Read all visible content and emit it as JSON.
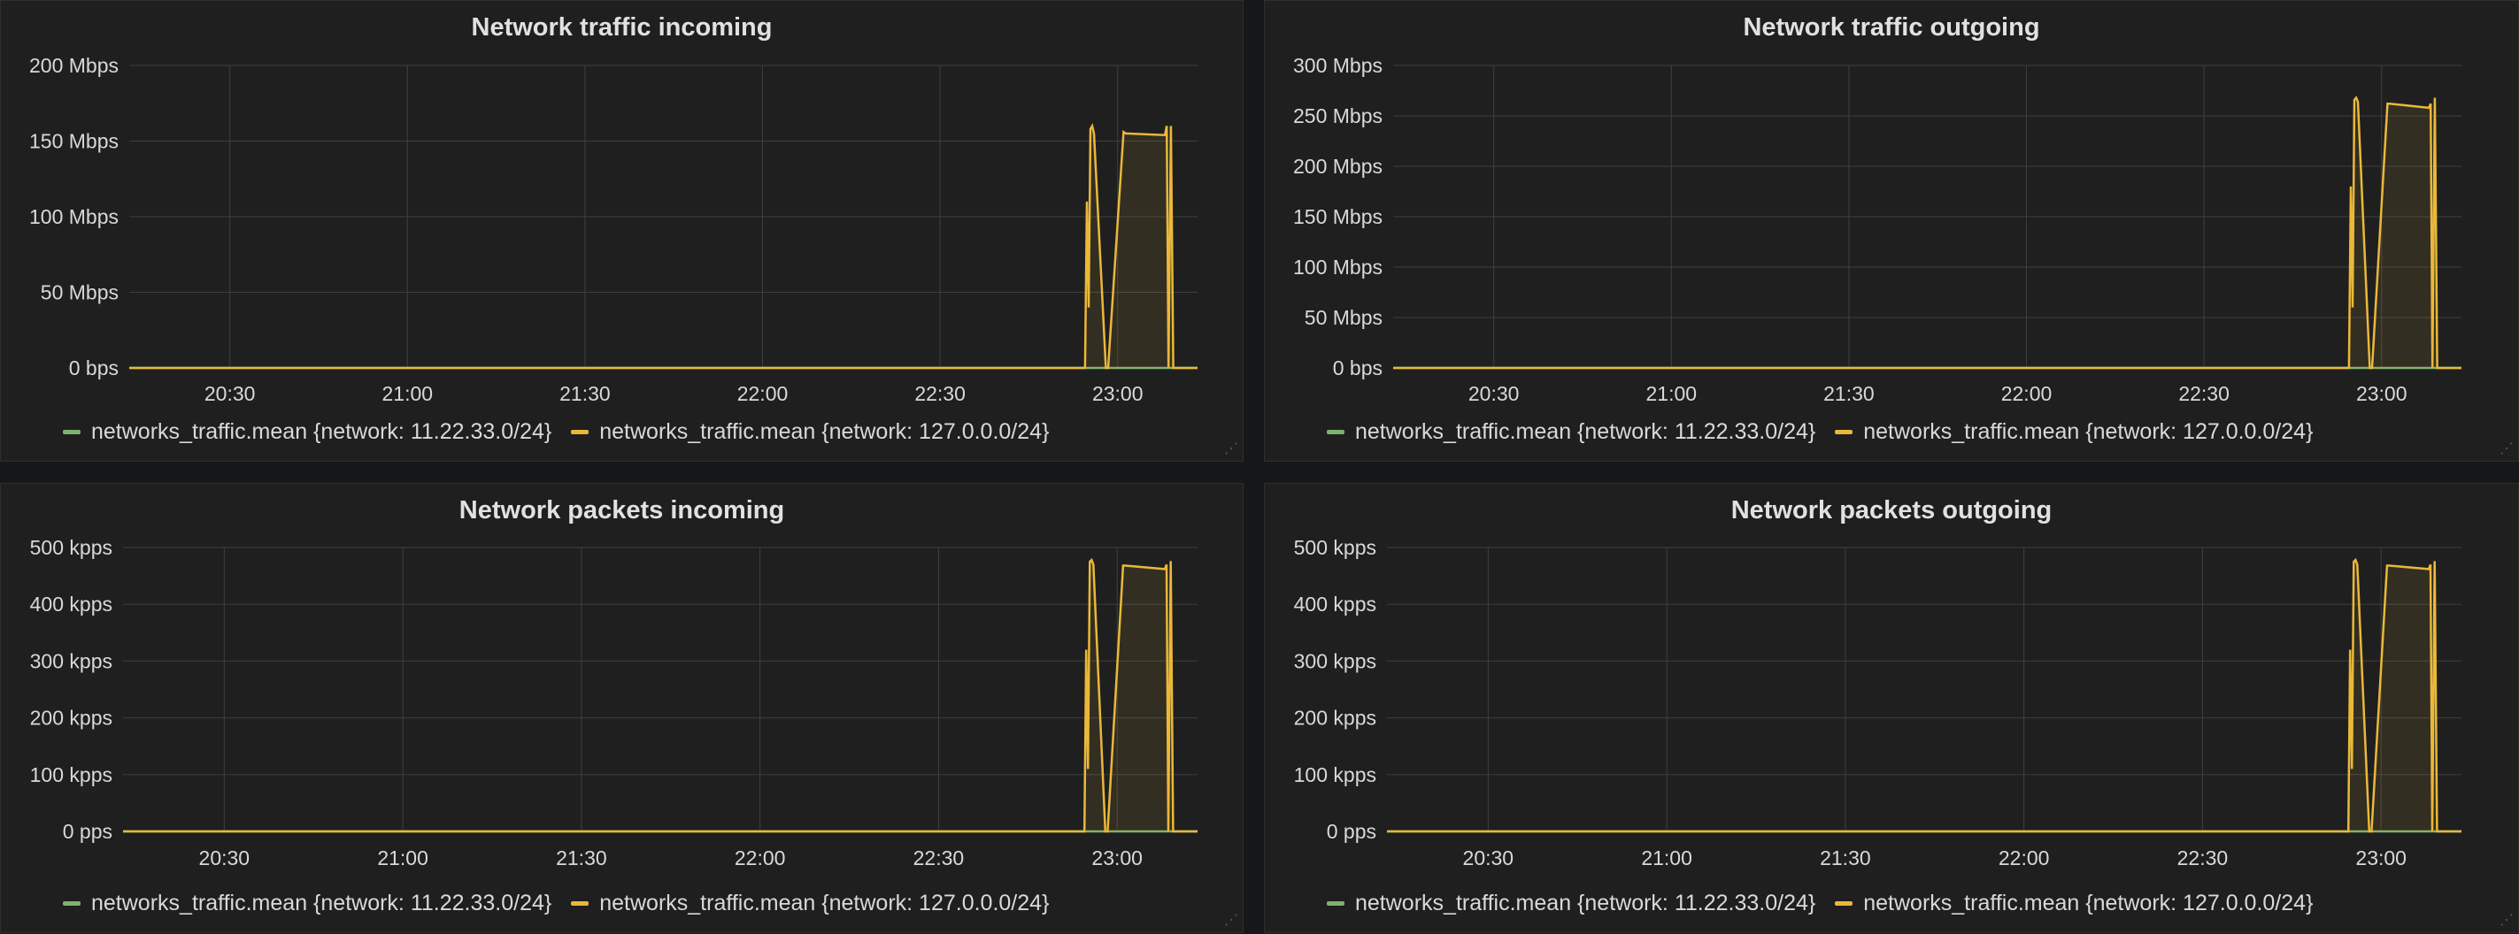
{
  "colors": {
    "series_green": "#7eb26d",
    "series_yellow": "#eab839",
    "grid": "#3e3f42",
    "panel_bg": "#1f1f20"
  },
  "panels": [
    {
      "title": "Network traffic incoming",
      "y_ticks": [
        "0 bps",
        "50 Mbps",
        "100 Mbps",
        "150 Mbps",
        "200 Mbps"
      ],
      "x_ticks": [
        "20:30",
        "21:00",
        "21:30",
        "22:00",
        "22:30",
        "23:00"
      ],
      "legend": [
        {
          "label": "networks_traffic.mean {network: 11.22.33.0/24}",
          "color": "#7eb26d"
        },
        {
          "label": "networks_traffic.mean {network: 127.0.0.0/24}",
          "color": "#eab839"
        }
      ]
    },
    {
      "title": "Network traffic outgoing",
      "y_ticks": [
        "0 bps",
        "50 Mbps",
        "100 Mbps",
        "150 Mbps",
        "200 Mbps",
        "250 Mbps",
        "300 Mbps"
      ],
      "x_ticks": [
        "20:30",
        "21:00",
        "21:30",
        "22:00",
        "22:30",
        "23:00"
      ],
      "legend": [
        {
          "label": "networks_traffic.mean {network: 11.22.33.0/24}",
          "color": "#7eb26d"
        },
        {
          "label": "networks_traffic.mean {network: 127.0.0.0/24}",
          "color": "#eab839"
        }
      ]
    },
    {
      "title": "Network packets incoming",
      "y_ticks": [
        "0 pps",
        "100 kpps",
        "200 kpps",
        "300 kpps",
        "400 kpps",
        "500 kpps"
      ],
      "x_ticks": [
        "20:30",
        "21:00",
        "21:30",
        "22:00",
        "22:30",
        "23:00"
      ],
      "legend": [
        {
          "label": "networks_traffic.mean {network: 11.22.33.0/24}",
          "color": "#7eb26d"
        },
        {
          "label": "networks_traffic.mean {network: 127.0.0.0/24}",
          "color": "#eab839"
        }
      ]
    },
    {
      "title": "Network packets outgoing",
      "y_ticks": [
        "0 pps",
        "100 kpps",
        "200 kpps",
        "300 kpps",
        "400 kpps",
        "500 kpps"
      ],
      "x_ticks": [
        "20:30",
        "21:00",
        "21:30",
        "22:00",
        "22:30",
        "23:00"
      ],
      "legend": [
        {
          "label": "networks_traffic.mean {network: 11.22.33.0/24}",
          "color": "#7eb26d"
        },
        {
          "label": "networks_traffic.mean {network: 127.0.0.0/24}",
          "color": "#eab839"
        }
      ]
    }
  ],
  "chart_data": [
    {
      "type": "area",
      "title": "Network traffic incoming",
      "xlabel": "",
      "ylabel": "",
      "ylim": [
        0,
        200
      ],
      "y_unit": "Mbps",
      "x_unit": "minutes",
      "x_tick_values": [
        30,
        60,
        90,
        120,
        150,
        180
      ],
      "xlim": [
        13,
        193.5
      ],
      "grid": true,
      "legend_position": "bottom",
      "series": [
        {
          "name": "networks_traffic.mean {network: 11.22.33.0/24}",
          "x": [
            13,
            193.5
          ],
          "values": [
            0,
            0
          ]
        },
        {
          "name": "networks_traffic.mean {network: 127.0.0.0/24}",
          "x": [
            13,
            174.5,
            174.8,
            175.1,
            175.4,
            175.7,
            176.0,
            178.0,
            178.4,
            181.0,
            181.4,
            188.0,
            188.3,
            188.6,
            189.0,
            189.4,
            193.5
          ],
          "values": [
            0,
            0,
            110,
            40,
            158,
            160,
            155,
            0,
            0,
            156,
            155,
            154,
            160,
            0,
            160,
            0,
            0
          ]
        }
      ]
    },
    {
      "type": "area",
      "title": "Network traffic outgoing",
      "xlabel": "",
      "ylabel": "",
      "ylim": [
        0,
        300
      ],
      "y_unit": "Mbps",
      "x_unit": "minutes",
      "x_tick_values": [
        30,
        60,
        90,
        120,
        150,
        180
      ],
      "xlim": [
        13,
        193.5
      ],
      "grid": true,
      "legend_position": "bottom",
      "series": [
        {
          "name": "networks_traffic.mean {network: 11.22.33.0/24}",
          "x": [
            13,
            193.5
          ],
          "values": [
            0,
            0
          ]
        },
        {
          "name": "networks_traffic.mean {network: 127.0.0.0/24}",
          "x": [
            13,
            174.5,
            174.8,
            175.1,
            175.4,
            175.7,
            176.0,
            178.0,
            178.4,
            181.0,
            181.4,
            188.0,
            188.3,
            188.6,
            189.0,
            189.4,
            193.5
          ],
          "values": [
            0,
            0,
            180,
            60,
            266,
            268,
            264,
            0,
            0,
            262,
            262,
            258,
            262,
            0,
            268,
            0,
            0
          ]
        }
      ]
    },
    {
      "type": "area",
      "title": "Network packets incoming",
      "xlabel": "",
      "ylabel": "",
      "ylim": [
        0,
        500
      ],
      "y_unit": "kpps",
      "x_unit": "minutes",
      "x_tick_values": [
        30,
        60,
        90,
        120,
        150,
        180
      ],
      "xlim": [
        13,
        193.5
      ],
      "grid": true,
      "legend_position": "bottom",
      "series": [
        {
          "name": "networks_traffic.mean {network: 11.22.33.0/24}",
          "x": [
            13,
            193.5
          ],
          "values": [
            0,
            0
          ]
        },
        {
          "name": "networks_traffic.mean {network: 127.0.0.0/24}",
          "x": [
            13,
            174.5,
            174.8,
            175.1,
            175.4,
            175.7,
            176.0,
            178.0,
            178.4,
            181.0,
            181.4,
            188.0,
            188.3,
            188.6,
            189.0,
            189.4,
            193.5
          ],
          "values": [
            0,
            0,
            320,
            110,
            475,
            478,
            470,
            0,
            0,
            468,
            468,
            462,
            470,
            0,
            476,
            0,
            0
          ]
        }
      ]
    },
    {
      "type": "area",
      "title": "Network packets outgoing",
      "xlabel": "",
      "ylabel": "",
      "ylim": [
        0,
        500
      ],
      "y_unit": "kpps",
      "x_unit": "minutes",
      "x_tick_values": [
        30,
        60,
        90,
        120,
        150,
        180
      ],
      "xlim": [
        13,
        193.5
      ],
      "grid": true,
      "legend_position": "bottom",
      "series": [
        {
          "name": "networks_traffic.mean {network: 11.22.33.0/24}",
          "x": [
            13,
            193.5
          ],
          "values": [
            0,
            0
          ]
        },
        {
          "name": "networks_traffic.mean {network: 127.0.0.0/24}",
          "x": [
            13,
            174.5,
            174.8,
            175.1,
            175.4,
            175.7,
            176.0,
            178.0,
            178.4,
            181.0,
            181.4,
            188.0,
            188.3,
            188.6,
            189.0,
            189.4,
            193.5
          ],
          "values": [
            0,
            0,
            320,
            110,
            475,
            478,
            470,
            0,
            0,
            468,
            468,
            462,
            470,
            0,
            476,
            0,
            0
          ]
        }
      ]
    }
  ]
}
